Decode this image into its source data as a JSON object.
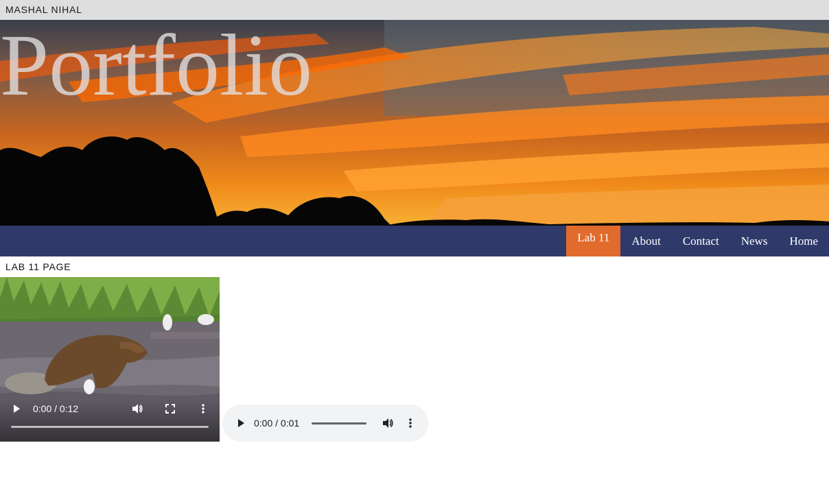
{
  "header": {
    "site_name": "MASHAL NIHAL"
  },
  "hero": {
    "title": "Portfolio"
  },
  "nav": {
    "items": [
      {
        "label": "Lab 11",
        "active": true
      },
      {
        "label": "About",
        "active": false
      },
      {
        "label": "Contact",
        "active": false
      },
      {
        "label": "News",
        "active": false
      },
      {
        "label": "Home",
        "active": false
      }
    ]
  },
  "main": {
    "heading": "LAB 11 PAGE"
  },
  "video": {
    "time": "0:00 / 0:12",
    "progress": 0
  },
  "audio": {
    "time": "0:00 / 0:01",
    "progress": 0
  },
  "colors": {
    "topbar": "#dedede",
    "navbar": "#2f3a6b",
    "nav_active": "#e06b2c",
    "audio_bg": "#f1f3f4"
  }
}
